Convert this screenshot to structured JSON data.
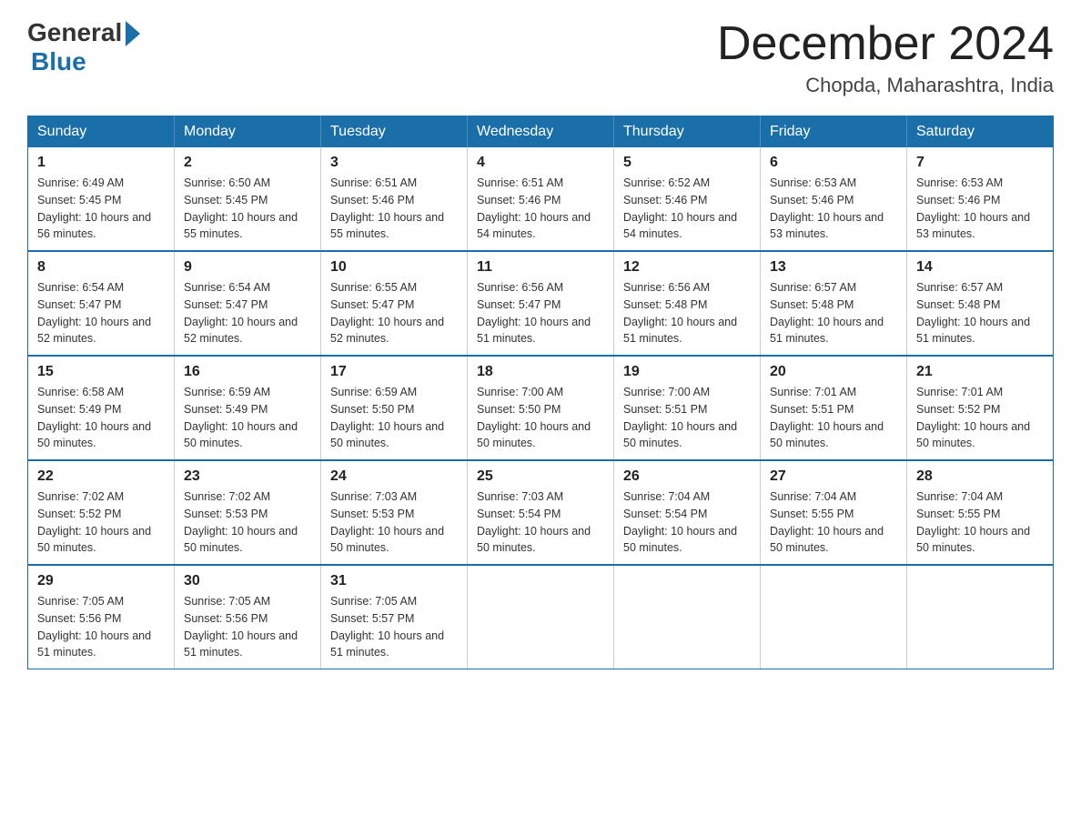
{
  "logo": {
    "general": "General",
    "blue": "Blue"
  },
  "title": "December 2024",
  "location": "Chopda, Maharashtra, India",
  "headers": [
    "Sunday",
    "Monday",
    "Tuesday",
    "Wednesday",
    "Thursday",
    "Friday",
    "Saturday"
  ],
  "weeks": [
    [
      {
        "day": "1",
        "sunrise": "6:49 AM",
        "sunset": "5:45 PM",
        "daylight": "10 hours and 56 minutes."
      },
      {
        "day": "2",
        "sunrise": "6:50 AM",
        "sunset": "5:45 PM",
        "daylight": "10 hours and 55 minutes."
      },
      {
        "day": "3",
        "sunrise": "6:51 AM",
        "sunset": "5:46 PM",
        "daylight": "10 hours and 55 minutes."
      },
      {
        "day": "4",
        "sunrise": "6:51 AM",
        "sunset": "5:46 PM",
        "daylight": "10 hours and 54 minutes."
      },
      {
        "day": "5",
        "sunrise": "6:52 AM",
        "sunset": "5:46 PM",
        "daylight": "10 hours and 54 minutes."
      },
      {
        "day": "6",
        "sunrise": "6:53 AM",
        "sunset": "5:46 PM",
        "daylight": "10 hours and 53 minutes."
      },
      {
        "day": "7",
        "sunrise": "6:53 AM",
        "sunset": "5:46 PM",
        "daylight": "10 hours and 53 minutes."
      }
    ],
    [
      {
        "day": "8",
        "sunrise": "6:54 AM",
        "sunset": "5:47 PM",
        "daylight": "10 hours and 52 minutes."
      },
      {
        "day": "9",
        "sunrise": "6:54 AM",
        "sunset": "5:47 PM",
        "daylight": "10 hours and 52 minutes."
      },
      {
        "day": "10",
        "sunrise": "6:55 AM",
        "sunset": "5:47 PM",
        "daylight": "10 hours and 52 minutes."
      },
      {
        "day": "11",
        "sunrise": "6:56 AM",
        "sunset": "5:47 PM",
        "daylight": "10 hours and 51 minutes."
      },
      {
        "day": "12",
        "sunrise": "6:56 AM",
        "sunset": "5:48 PM",
        "daylight": "10 hours and 51 minutes."
      },
      {
        "day": "13",
        "sunrise": "6:57 AM",
        "sunset": "5:48 PM",
        "daylight": "10 hours and 51 minutes."
      },
      {
        "day": "14",
        "sunrise": "6:57 AM",
        "sunset": "5:48 PM",
        "daylight": "10 hours and 51 minutes."
      }
    ],
    [
      {
        "day": "15",
        "sunrise": "6:58 AM",
        "sunset": "5:49 PM",
        "daylight": "10 hours and 50 minutes."
      },
      {
        "day": "16",
        "sunrise": "6:59 AM",
        "sunset": "5:49 PM",
        "daylight": "10 hours and 50 minutes."
      },
      {
        "day": "17",
        "sunrise": "6:59 AM",
        "sunset": "5:50 PM",
        "daylight": "10 hours and 50 minutes."
      },
      {
        "day": "18",
        "sunrise": "7:00 AM",
        "sunset": "5:50 PM",
        "daylight": "10 hours and 50 minutes."
      },
      {
        "day": "19",
        "sunrise": "7:00 AM",
        "sunset": "5:51 PM",
        "daylight": "10 hours and 50 minutes."
      },
      {
        "day": "20",
        "sunrise": "7:01 AM",
        "sunset": "5:51 PM",
        "daylight": "10 hours and 50 minutes."
      },
      {
        "day": "21",
        "sunrise": "7:01 AM",
        "sunset": "5:52 PM",
        "daylight": "10 hours and 50 minutes."
      }
    ],
    [
      {
        "day": "22",
        "sunrise": "7:02 AM",
        "sunset": "5:52 PM",
        "daylight": "10 hours and 50 minutes."
      },
      {
        "day": "23",
        "sunrise": "7:02 AM",
        "sunset": "5:53 PM",
        "daylight": "10 hours and 50 minutes."
      },
      {
        "day": "24",
        "sunrise": "7:03 AM",
        "sunset": "5:53 PM",
        "daylight": "10 hours and 50 minutes."
      },
      {
        "day": "25",
        "sunrise": "7:03 AM",
        "sunset": "5:54 PM",
        "daylight": "10 hours and 50 minutes."
      },
      {
        "day": "26",
        "sunrise": "7:04 AM",
        "sunset": "5:54 PM",
        "daylight": "10 hours and 50 minutes."
      },
      {
        "day": "27",
        "sunrise": "7:04 AM",
        "sunset": "5:55 PM",
        "daylight": "10 hours and 50 minutes."
      },
      {
        "day": "28",
        "sunrise": "7:04 AM",
        "sunset": "5:55 PM",
        "daylight": "10 hours and 50 minutes."
      }
    ],
    [
      {
        "day": "29",
        "sunrise": "7:05 AM",
        "sunset": "5:56 PM",
        "daylight": "10 hours and 51 minutes."
      },
      {
        "day": "30",
        "sunrise": "7:05 AM",
        "sunset": "5:56 PM",
        "daylight": "10 hours and 51 minutes."
      },
      {
        "day": "31",
        "sunrise": "7:05 AM",
        "sunset": "5:57 PM",
        "daylight": "10 hours and 51 minutes."
      },
      null,
      null,
      null,
      null
    ]
  ]
}
